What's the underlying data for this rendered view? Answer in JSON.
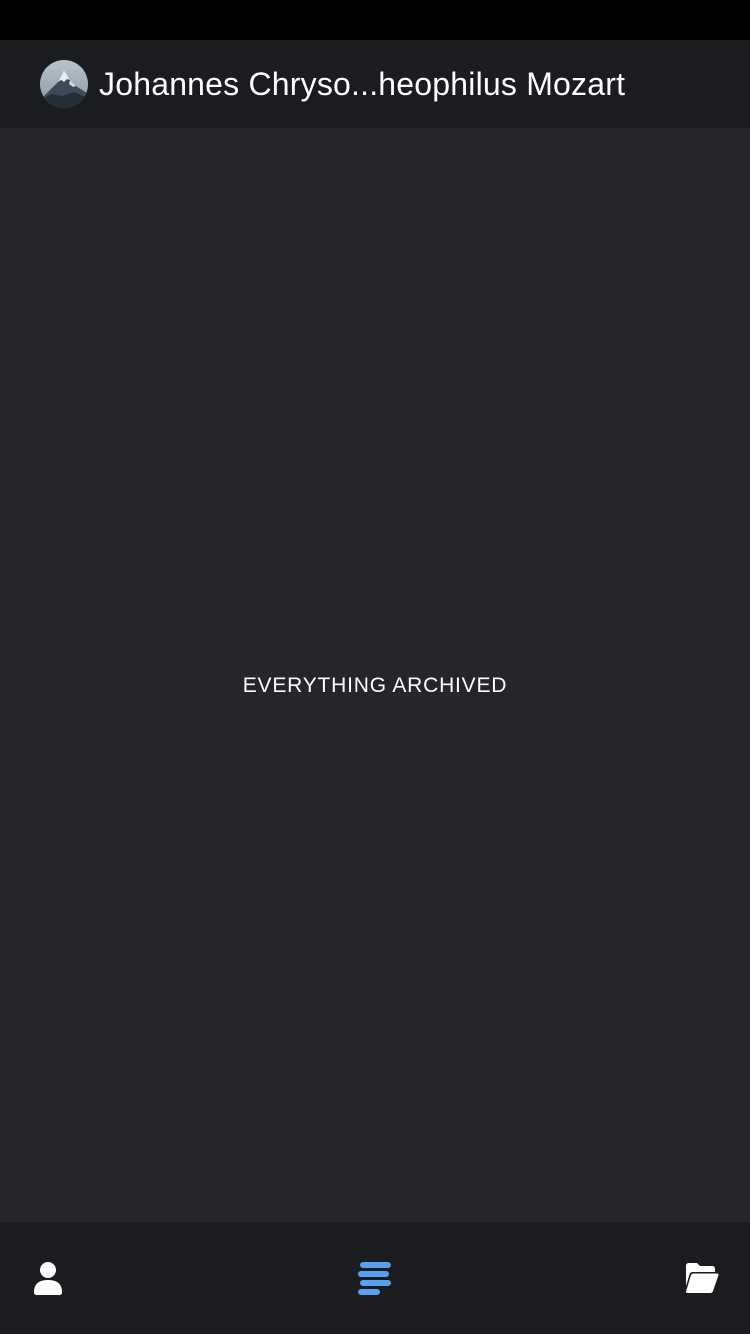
{
  "header": {
    "title": "Johannes Chryso...heophilus Mozart",
    "avatar_icon": "mountain-avatar"
  },
  "main": {
    "empty_message": "EVERYTHING ARCHIVED"
  },
  "tab_bar": {
    "tabs": [
      {
        "icon": "user-icon",
        "active": false
      },
      {
        "icon": "feed-lines-icon",
        "active": true
      },
      {
        "icon": "folder-open-icon",
        "active": false
      }
    ]
  },
  "colors": {
    "background": "#25262b",
    "bar_background": "#1b1c1f",
    "status_bar": "#000000",
    "text": "#ffffff",
    "active_accent": "#5aa0f0",
    "inactive_icon": "#ffffff"
  }
}
